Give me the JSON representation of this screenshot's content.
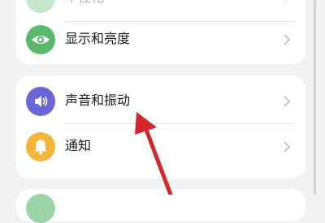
{
  "settings": {
    "items": [
      {
        "label": "个性化",
        "icon": "personalize-icon",
        "color": "#58b96c"
      },
      {
        "label": "显示和亮度",
        "icon": "eye-icon",
        "color": "#58b96c"
      },
      {
        "label": "声音和振动",
        "icon": "speaker-icon",
        "color": "#6b66d8"
      },
      {
        "label": "通知",
        "icon": "bell-icon",
        "color": "#f4b53b"
      }
    ]
  },
  "annotation": {
    "arrow_color": "#d7262a",
    "arrow_target": "声音和振动"
  }
}
